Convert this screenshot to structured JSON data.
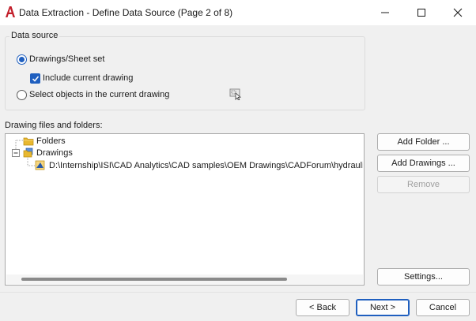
{
  "window": {
    "title": "Data Extraction - Define Data Source (Page 2 of 8)",
    "app_icon": "autocad-icon",
    "accent": "#c21e2a"
  },
  "data_source": {
    "group_label": "Data source",
    "option_drawings": {
      "label": "Drawings/Sheet set",
      "checked": true
    },
    "option_include": {
      "label": "Include current drawing",
      "checked": true
    },
    "option_select": {
      "label": "Select objects in the current drawing",
      "checked": false
    },
    "select_objects_icon": "select-objects-icon"
  },
  "files": {
    "label": "Drawing files and folders:",
    "tree": {
      "folders_label": "Folders",
      "drawings_label": "Drawings",
      "drawing_path": "D:\\Internship\\ISI\\CAD Analytics\\CAD samples\\OEM Drawings\\CADForum\\hydraulic_uni"
    }
  },
  "buttons": {
    "add_folder": "Add Folder ...",
    "add_drawings": "Add Drawings ...",
    "remove": "Remove",
    "settings": "Settings...",
    "back": "< Back",
    "next": "Next >",
    "cancel": "Cancel"
  },
  "colors": {
    "accent_blue": "#1f5fbf",
    "folder_yellow": "#e8b830"
  }
}
